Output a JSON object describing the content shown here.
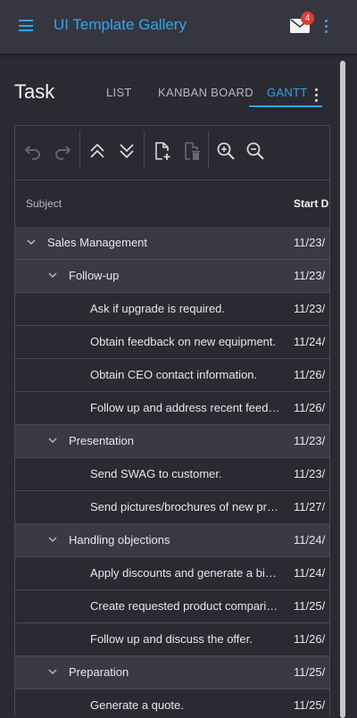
{
  "app": {
    "title": "UI Template Gallery",
    "mail_badge": "4",
    "accent": "#2ea6ef"
  },
  "page": {
    "title": "Task"
  },
  "tabs": [
    {
      "label": "LIST",
      "active": false
    },
    {
      "label": "KANBAN BOARD",
      "active": false
    },
    {
      "label": "GANTT",
      "active": true
    }
  ],
  "toolbar": {
    "buttons": [
      "undo-icon",
      "redo-icon",
      "collapse-all-icon",
      "expand-all-icon",
      "add-task-icon",
      "delete-task-icon",
      "zoom-in-icon",
      "zoom-out-icon"
    ]
  },
  "grid": {
    "columns": {
      "subject": "Subject",
      "start": "Start D"
    },
    "rows": [
      {
        "subject": "Sales Management",
        "date": "11/23/",
        "level": 0,
        "parent": true
      },
      {
        "subject": "Follow-up",
        "date": "11/23/",
        "level": 1,
        "parent": true
      },
      {
        "subject": "Ask if upgrade is required.",
        "date": "11/23/",
        "level": 2,
        "parent": false
      },
      {
        "subject": "Obtain feedback on new equipment.",
        "date": "11/24/",
        "level": 2,
        "parent": false
      },
      {
        "subject": "Obtain CEO contact information.",
        "date": "11/26/",
        "level": 2,
        "parent": false
      },
      {
        "subject": "Follow up and address recent feed…",
        "date": "11/26/",
        "level": 2,
        "parent": false
      },
      {
        "subject": "Presentation",
        "date": "11/23/",
        "level": 1,
        "parent": true
      },
      {
        "subject": "Send SWAG to customer.",
        "date": "11/23/",
        "level": 2,
        "parent": false
      },
      {
        "subject": "Send pictures/brochures of new pr…",
        "date": "11/27/",
        "level": 2,
        "parent": false
      },
      {
        "subject": "Handling objections",
        "date": "11/24/",
        "level": 1,
        "parent": true
      },
      {
        "subject": "Apply discounts and generate a bin…",
        "date": "11/24/",
        "level": 2,
        "parent": false
      },
      {
        "subject": "Create requested product compari…",
        "date": "11/25/",
        "level": 2,
        "parent": false
      },
      {
        "subject": "Follow up and discuss the offer.",
        "date": "11/26/",
        "level": 2,
        "parent": false
      },
      {
        "subject": "Preparation",
        "date": "11/25/",
        "level": 1,
        "parent": true
      },
      {
        "subject": "Generate a quote.",
        "date": "11/25/",
        "level": 2,
        "parent": false
      }
    ]
  }
}
